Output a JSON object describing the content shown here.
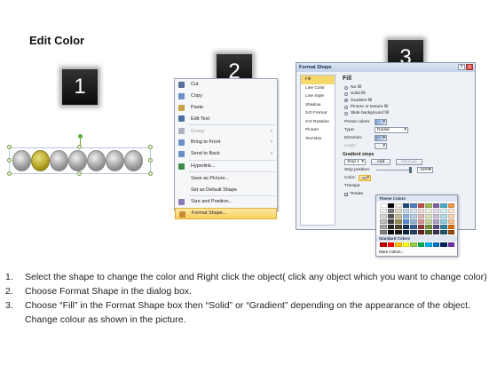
{
  "title": "Edit Color",
  "badges": [
    "1",
    "2",
    "3"
  ],
  "context_menu": {
    "items": [
      {
        "label": "Cut",
        "icon": "scissors-icon",
        "disabled": false,
        "submenu": false
      },
      {
        "label": "Copy",
        "icon": "copy-icon",
        "disabled": false,
        "submenu": false
      },
      {
        "label": "Paste",
        "icon": "paste-icon",
        "disabled": false,
        "submenu": false
      },
      {
        "label": "Edit Text",
        "icon": "edit-text-icon",
        "disabled": false,
        "submenu": false
      },
      {
        "label": "Group",
        "icon": "group-icon",
        "disabled": true,
        "submenu": true
      },
      {
        "label": "Bring to Front",
        "icon": "bring-front-icon",
        "disabled": false,
        "submenu": true
      },
      {
        "label": "Send to Back",
        "icon": "send-back-icon",
        "disabled": false,
        "submenu": true
      },
      {
        "label": "Hyperlink...",
        "icon": "hyperlink-icon",
        "disabled": false,
        "submenu": false
      },
      {
        "label": "Save as Picture...",
        "icon": "",
        "disabled": false,
        "submenu": false
      },
      {
        "label": "Set as Default Shape",
        "icon": "",
        "disabled": false,
        "submenu": false
      },
      {
        "label": "Size and Position...",
        "icon": "size-position-icon",
        "disabled": false,
        "submenu": false
      },
      {
        "label": "Format Shape...",
        "icon": "format-shape-icon",
        "disabled": false,
        "submenu": false,
        "active": true
      }
    ]
  },
  "format_dialog": {
    "title": "Format Shape",
    "title_buttons": [
      "?",
      "X"
    ],
    "nav": [
      "Fill",
      "Line Color",
      "Line Style",
      "Shadow",
      "3-D Format",
      "3-D Rotation",
      "Picture",
      "Text Box"
    ],
    "panel_title": "Fill",
    "fill_options": [
      {
        "label": "No fill",
        "selected": false
      },
      {
        "label": "Solid fill",
        "selected": false
      },
      {
        "label": "Gradient fill",
        "selected": true
      },
      {
        "label": "Picture or texture fill",
        "selected": false
      },
      {
        "label": "Slide background fill",
        "selected": false
      }
    ],
    "preset_colors_label": "Preset colors:",
    "type_label": "Type:",
    "type_value": "Radial",
    "direction_label": "Direction:",
    "angle_label": "Angle:",
    "gradient_stops_label": "Gradient stops",
    "stop_value": "Stop 1",
    "add_label": "Add",
    "remove_label": "Remove",
    "stop_position_label": "Stop position:",
    "stop_position_value": "100%",
    "color_label": "Color:",
    "transparency_label": "Transpa",
    "rotate_label": "Rotate"
  },
  "color_popup": {
    "theme_header": "Theme Colors",
    "standard_header": "Standard Colors",
    "more_label": "More Colors...",
    "theme_top": [
      "#ffffff",
      "#000000",
      "#eeece1",
      "#1f497d",
      "#4f81bd",
      "#c0504d",
      "#9bbb59",
      "#8064a2",
      "#4bacc6",
      "#f79646"
    ],
    "theme_shades": [
      [
        "#f2f2f2",
        "#7f7f7f",
        "#ddd9c3",
        "#c6d9f0",
        "#dbe5f1",
        "#f2dcdb",
        "#ebf1dd",
        "#e5e0ec",
        "#dbeef3",
        "#fdeada"
      ],
      [
        "#d8d8d8",
        "#595959",
        "#c4bd97",
        "#8db3e2",
        "#b8cce4",
        "#e5b9b7",
        "#d7e3bc",
        "#ccc1d9",
        "#b7dde8",
        "#fbd5b5"
      ],
      [
        "#bfbfbf",
        "#3f3f3f",
        "#938953",
        "#548dd4",
        "#95b3d7",
        "#d99694",
        "#c3d69b",
        "#b2a2c7",
        "#92cddc",
        "#fac08f"
      ],
      [
        "#a5a5a5",
        "#262626",
        "#494429",
        "#17365d",
        "#366092",
        "#953734",
        "#76923c",
        "#5f497a",
        "#31859b",
        "#e36c09"
      ],
      [
        "#7f7f7f",
        "#0c0c0c",
        "#1d1b10",
        "#0f243e",
        "#244061",
        "#632423",
        "#4f6128",
        "#3f3151",
        "#205867",
        "#974806"
      ]
    ],
    "standard": [
      "#c00000",
      "#ff0000",
      "#ffc000",
      "#ffff00",
      "#92d050",
      "#00b050",
      "#00b0f0",
      "#0070c0",
      "#002060",
      "#7030a0"
    ]
  },
  "instructions": [
    {
      "num": "1.",
      "text": "Select the shape to change the color and Right click the object( click any object which you want to change color)"
    },
    {
      "num": "2.",
      "text": "Choose Format Shape in the dialog box."
    },
    {
      "num": "3.",
      "text": "Choose “Fill” in the Format Shape box then “Solid” or “Gradient” depending on the appearance of the object. Change colour as shown in the picture."
    }
  ]
}
